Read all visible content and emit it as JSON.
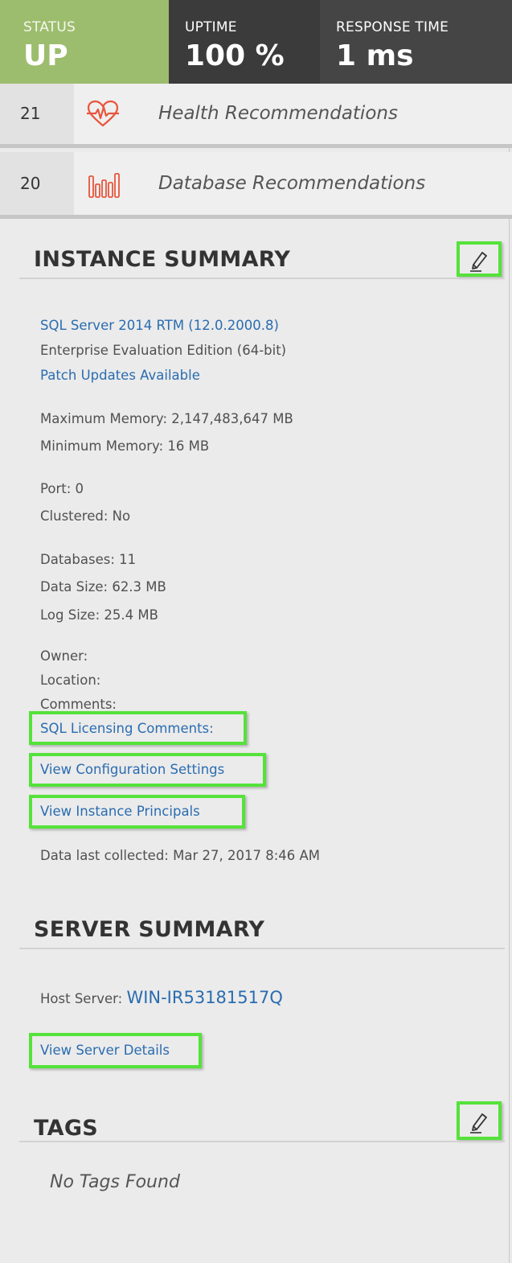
{
  "status": {
    "label": "STATUS",
    "value": "UP",
    "color": "#9dbd6e"
  },
  "uptime": {
    "label": "UPTIME",
    "value": "100 %"
  },
  "response": {
    "label": "RESPONSE TIME",
    "value": "1 ms"
  },
  "recommendations": [
    {
      "count": "21",
      "label": "Health Recommendations",
      "icon": "heart-pulse-icon"
    },
    {
      "count": "20",
      "label": "Database Recommendations",
      "icon": "bar-chart-icon"
    }
  ],
  "instance": {
    "title": "INSTANCE SUMMARY",
    "version_link": "SQL Server 2014 RTM (12.0.2000.8)",
    "edition": "Enterprise Evaluation Edition (64-bit)",
    "patch_link": "Patch Updates Available",
    "max_memory": "Maximum Memory: 2,147,483,647 MB",
    "min_memory": "Minimum Memory: 16 MB",
    "port": "Port: 0",
    "clustered": "Clustered: No",
    "databases": "Databases: 11",
    "data_size": "Data Size: 62.3 MB",
    "log_size": "Log Size: 25.4 MB",
    "owner": "Owner:",
    "location": "Location:",
    "comments": "Comments:",
    "licensing_link": "SQL Licensing Comments:",
    "config_link": "View Configuration Settings",
    "principals_link": "View Instance Principals",
    "last_collected": "Data last collected: Mar 27, 2017 8:46 AM"
  },
  "server": {
    "title": "SERVER SUMMARY",
    "host_label": "Host Server: ",
    "host_link": "WIN-IR53181517Q",
    "details_link": "View Server Details"
  },
  "tags": {
    "title": "TAGS",
    "empty": "No Tags Found"
  },
  "colors": {
    "highlight": "#55e23a",
    "link": "#2a6cb0",
    "accent": "#e8553c"
  }
}
